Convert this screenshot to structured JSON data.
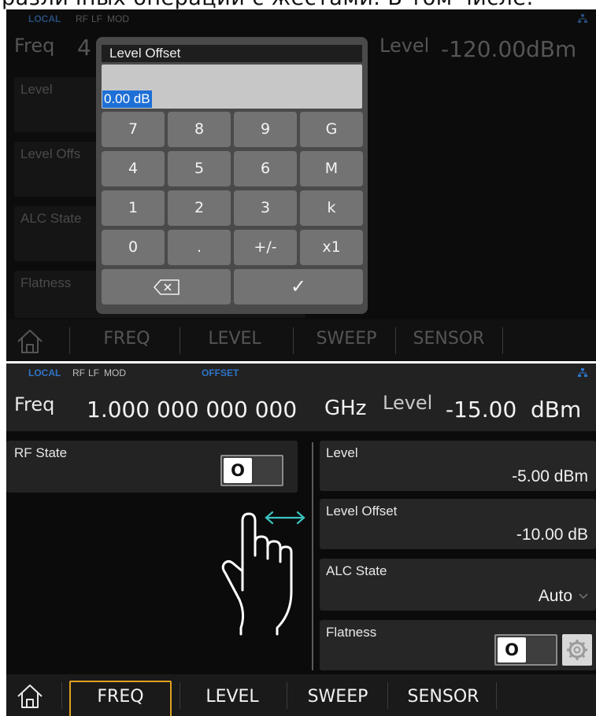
{
  "caption": {
    "text": "различных операций с жестами. В том числе:"
  },
  "background_screen": {
    "status": {
      "local": "LOCAL",
      "rf": "RF",
      "lf": "LF",
      "mod": "MOD"
    },
    "header": {
      "freq_label": "Freq",
      "freq_value_partial": "4",
      "level_label": "Level",
      "level_value": "-120.00",
      "level_unit": "dBm"
    },
    "left_tiles": [
      {
        "label": "Level"
      },
      {
        "label": "Level Offs"
      },
      {
        "label": "ALC State"
      },
      {
        "label": "Flatness"
      }
    ],
    "tabs": [
      "FREQ",
      "LEVEL",
      "SWEEP",
      "SENSOR"
    ]
  },
  "dialog": {
    "title": "Level Offset",
    "input_value": "0.00 dB",
    "keys": [
      [
        "7",
        "8",
        "9",
        "G"
      ],
      [
        "4",
        "5",
        "6",
        "M"
      ],
      [
        "1",
        "2",
        "3",
        "k"
      ],
      [
        "0",
        ".",
        "+/-",
        "x1"
      ]
    ],
    "backspace_icon": "backspace-icon",
    "confirm_icon": "checkmark-icon",
    "confirm_glyph": "✓"
  },
  "main_screen": {
    "status": {
      "local": "LOCAL",
      "rf": "RF",
      "lf": "LF",
      "mod": "MOD",
      "offset": "OFFSET"
    },
    "header": {
      "freq_label": "Freq",
      "freq_value": "1.000 000 000 000",
      "freq_unit": "GHz",
      "level_label": "Level",
      "level_value": "-15.00",
      "level_unit": "dBm"
    },
    "rf_state": {
      "label": "RF State",
      "toggle_text": "O",
      "state": "off"
    },
    "right_tiles": {
      "level": {
        "label": "Level",
        "value": "-5.00 dBm"
      },
      "level_offset": {
        "label": "Level Offset",
        "value": "-10.00 dB"
      },
      "alc_state": {
        "label": "ALC State",
        "value": "Auto"
      },
      "flatness": {
        "label": "Flatness",
        "toggle_text": "O",
        "state": "off"
      }
    },
    "gesture": {
      "icon": "swipe-hand-icon",
      "arrow_color": "#3cc3c0"
    },
    "tabs": [
      "FREQ",
      "LEVEL",
      "SWEEP",
      "SENSOR"
    ],
    "selected_tab": "FREQ"
  },
  "colors": {
    "accent_blue": "#2e74c9",
    "selection_blue": "#1e6fd6",
    "tab_highlight": "#e0a11e",
    "gesture_teal": "#3cc3c0"
  }
}
